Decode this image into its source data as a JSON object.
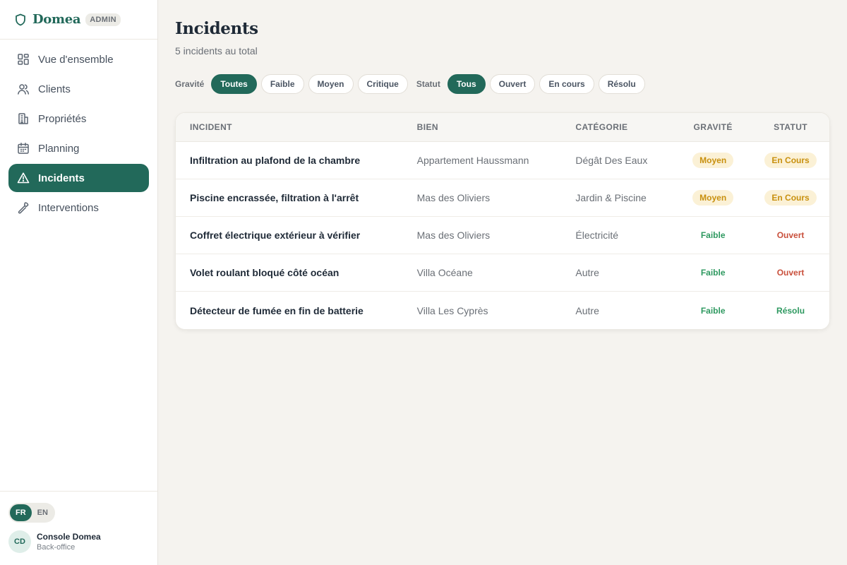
{
  "brand": {
    "name": "Domea",
    "badge": "ADMIN",
    "icon": "shield-icon"
  },
  "nav": [
    {
      "label": "Vue d'ensemble",
      "icon": "dashboard-grid-icon",
      "active": false
    },
    {
      "label": "Clients",
      "icon": "users-icon",
      "active": false
    },
    {
      "label": "Propriétés",
      "icon": "building-icon",
      "active": false
    },
    {
      "label": "Planning",
      "icon": "calendar-icon",
      "active": false
    },
    {
      "label": "Incidents",
      "icon": "warning-triangle-icon",
      "active": true
    },
    {
      "label": "Interventions",
      "icon": "wrench-icon",
      "active": false
    }
  ],
  "lang": {
    "fr": "FR",
    "en": "EN",
    "selected": "FR"
  },
  "user": {
    "initials": "CD",
    "name": "Console Domea",
    "role": "Back-office"
  },
  "page": {
    "title": "Incidents",
    "subtitle": "5 incidents au total"
  },
  "filters": {
    "severity_label": "Gravité",
    "severity_options": [
      "Toutes",
      "Faible",
      "Moyen",
      "Critique"
    ],
    "severity_selected": "Toutes",
    "status_label": "Statut",
    "status_options": [
      "Tous",
      "Ouvert",
      "En cours",
      "Résolu"
    ],
    "status_selected": "Tous"
  },
  "table": {
    "headers": {
      "incident": "INCIDENT",
      "property": "BIEN",
      "category": "CATÉGORIE",
      "severity": "GRAVITÉ",
      "status": "STATUT"
    },
    "rows": [
      {
        "incident": "Infiltration au plafond de la chambre",
        "property": "Appartement Haussmann",
        "category": "Dégât Des Eaux",
        "severity": "Moyen",
        "status": "En Cours"
      },
      {
        "incident": "Piscine encrassée, filtration à l'arrêt",
        "property": "Mas des Oliviers",
        "category": "Jardin & Piscine",
        "severity": "Moyen",
        "status": "En Cours"
      },
      {
        "incident": "Coffret électrique extérieur à vérifier",
        "property": "Mas des Oliviers",
        "category": "Électricité",
        "severity": "Faible",
        "status": "Ouvert"
      },
      {
        "incident": "Volet roulant bloqué côté océan",
        "property": "Villa Océane",
        "category": "Autre",
        "severity": "Faible",
        "status": "Ouvert"
      },
      {
        "incident": "Détecteur de fumée en fin de batterie",
        "property": "Villa Les Cyprès",
        "category": "Autre",
        "severity": "Faible",
        "status": "Résolu"
      }
    ]
  },
  "colors": {
    "primary": "#22695a",
    "amber": "#c8900e",
    "green": "#2e9960",
    "red": "#c9503c",
    "background": "#f5f3ef"
  }
}
